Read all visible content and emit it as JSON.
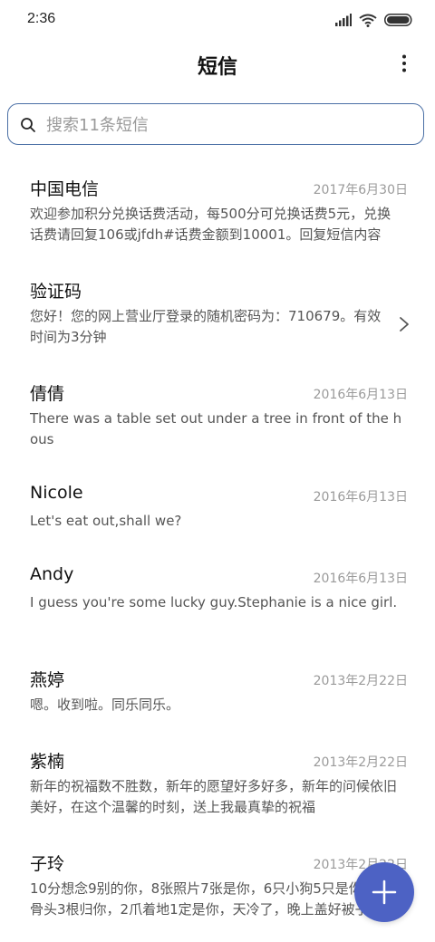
{
  "status_bar": {
    "time": "2:36",
    "icons": [
      "signal-icon",
      "wifi-icon",
      "battery-icon"
    ]
  },
  "header": {
    "title": "短信",
    "menu_icon": "more-vert-icon"
  },
  "search": {
    "placeholder": "搜索11条短信",
    "value": "",
    "icon": "search-icon"
  },
  "conversations": [
    {
      "name": "中国电信",
      "date": "2017年6月30日",
      "snippet": "欢迎参加积分兑换话费活动，每500分可兑换话费5元，兑换话费请回复106或jfdh#话费金额到10001。回复短信内容"
    },
    {
      "name": "验证码",
      "date": "",
      "snippet": "您好！您的网上营业厅登录的随机密码为：710679。有效时间为3分钟",
      "chevron_icon": "chevron-right-icon"
    },
    {
      "name": "倩倩",
      "date": "2016年6月13日",
      "snippet": "There was a table set out under a tree in front of the hous"
    },
    {
      "name": "Nicole",
      "date": "2016年6月13日",
      "snippet": "Let's eat out,shall we?"
    },
    {
      "name": "Andy",
      "date": "2016年6月13日",
      "snippet": "I guess you're some lucky guy.Stephanie is a nice girl."
    },
    {
      "name": "燕婷",
      "date": "2013年2月22日",
      "snippet": "嗯。收到啦。同乐同乐。"
    },
    {
      "name": "紫楠",
      "date": "2013年2月22日",
      "snippet": "新年的祝福数不胜数，新年的愿望好多好多，新年的问候依旧美好，在这个温馨的时刻，送上我最真挚的祝福"
    },
    {
      "name": "子玲",
      "date": "2013年2月22日",
      "snippet": "10分想念9别的你，8张照片7张是你，6只小狗5只是你，4根骨头3根归你，2爪着地1定是你，天冷了，晚上盖好被子"
    }
  ],
  "fab": {
    "icon": "plus-icon"
  },
  "colors": {
    "accent": "#4d62c4",
    "search_border": "#4a6fa5",
    "secondary_text": "#9a9a9a"
  }
}
